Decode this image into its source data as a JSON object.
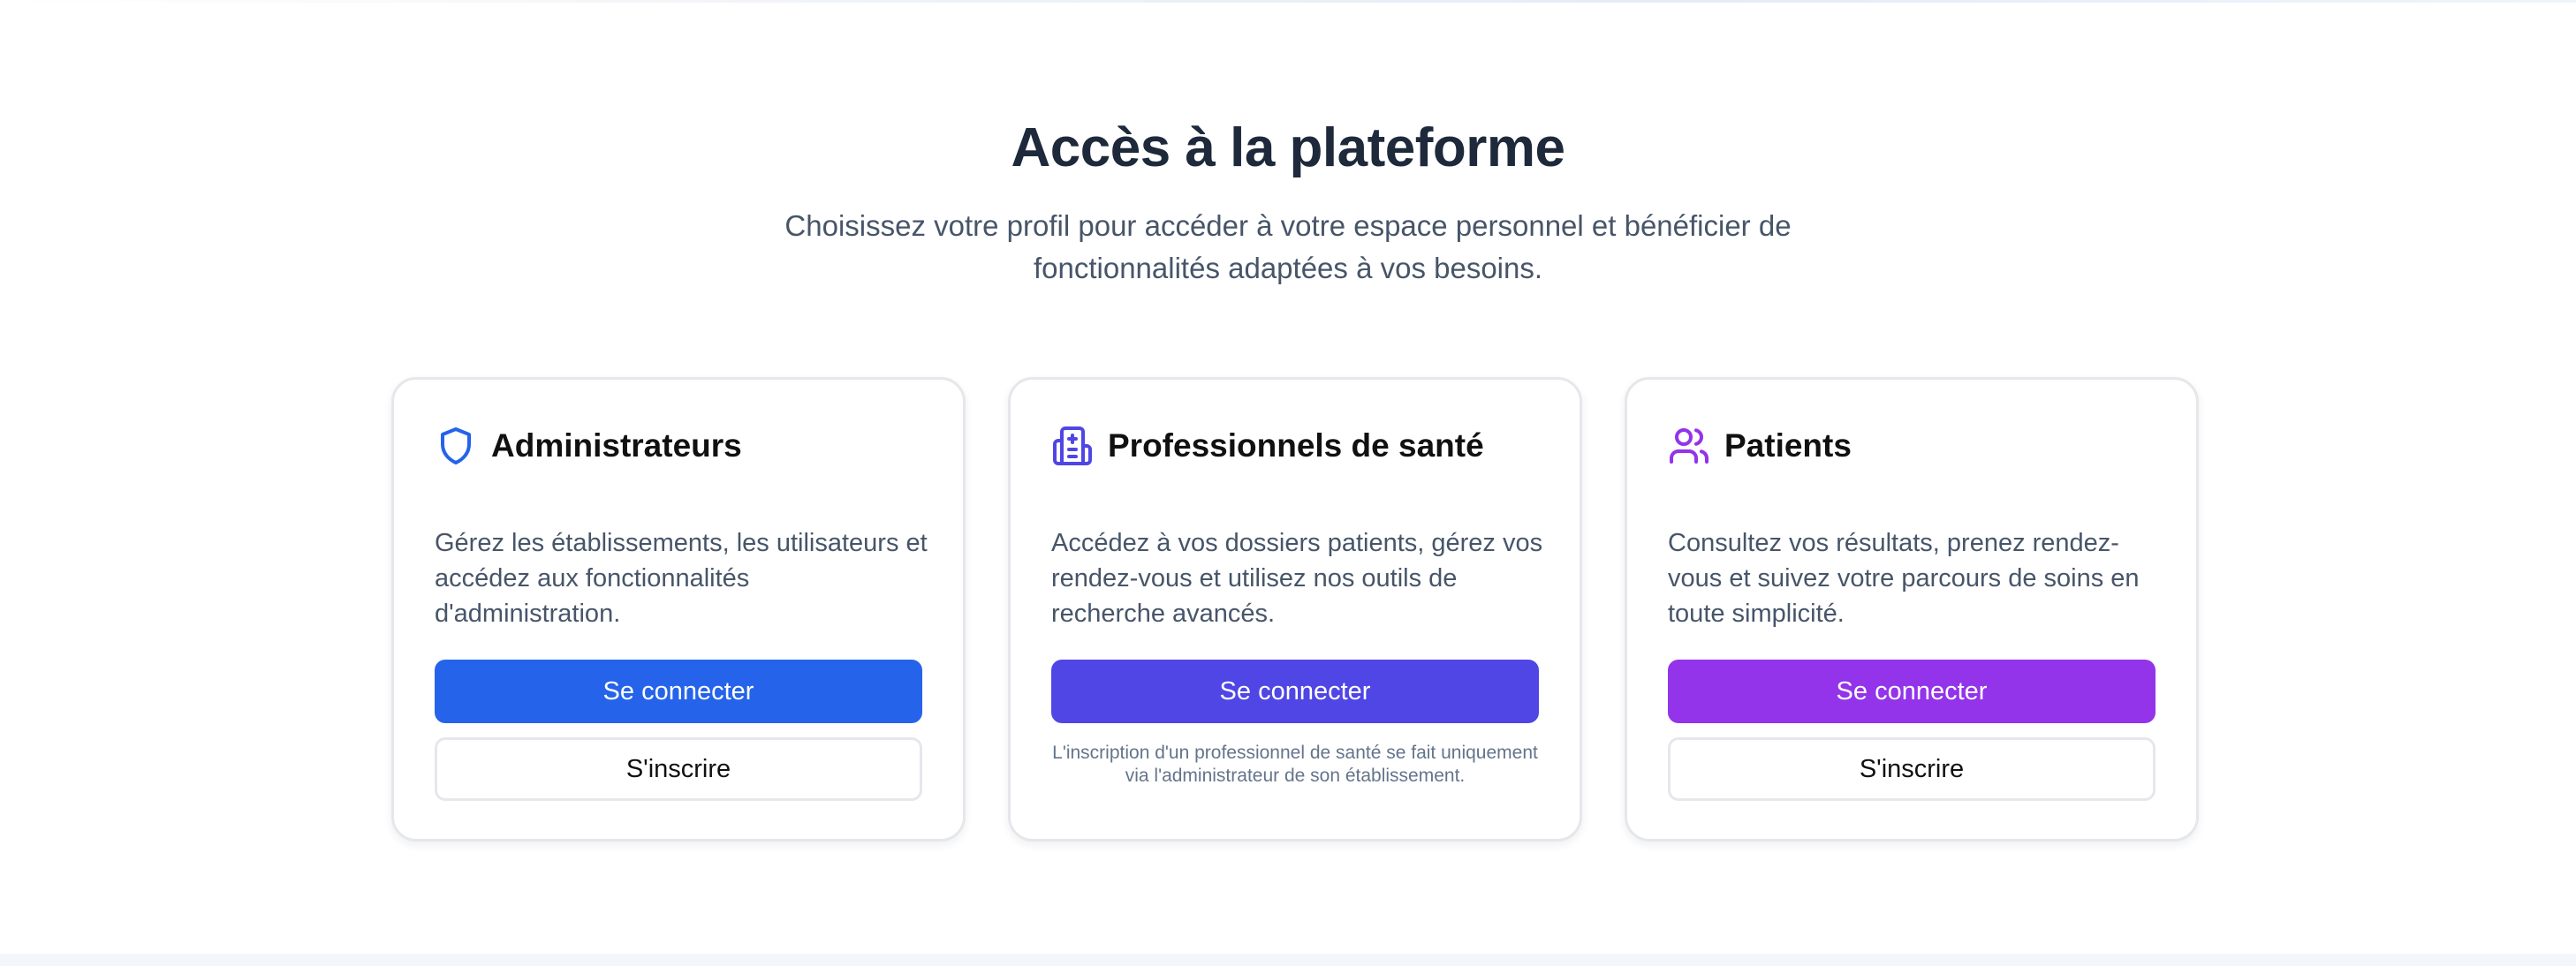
{
  "section": {
    "title": "Accès à la plateforme",
    "subtitle": "Choisissez votre profil pour accéder à votre espace personnel et bénéficier de fonctionnalités adaptées à vos besoins."
  },
  "cards": [
    {
      "icon": "shield-icon",
      "accent_color": "#2563eb",
      "title": "Administrateurs",
      "description": "Gérez les établissements, les utilisateurs et accédez aux fonctionnalités d'administration.",
      "login_label": "Se connecter",
      "signup_label": "S'inscrire"
    },
    {
      "icon": "hospital-icon",
      "accent_color": "#4f46e5",
      "title": "Professionnels de santé",
      "description": "Accédez à vos dossiers patients, gérez vos rendez-vous et utilisez nos outils de recherche avancés.",
      "login_label": "Se connecter",
      "note": "L'inscription d'un professionnel de santé se fait uniquement via l'administrateur de son établissement."
    },
    {
      "icon": "users-icon",
      "accent_color": "#9333ea",
      "title": "Patients",
      "description": "Consultez vos résultats, prenez rendez-vous et suivez votre parcours de soins en toute simplicité.",
      "login_label": "Se connecter",
      "signup_label": "S'inscrire"
    }
  ]
}
